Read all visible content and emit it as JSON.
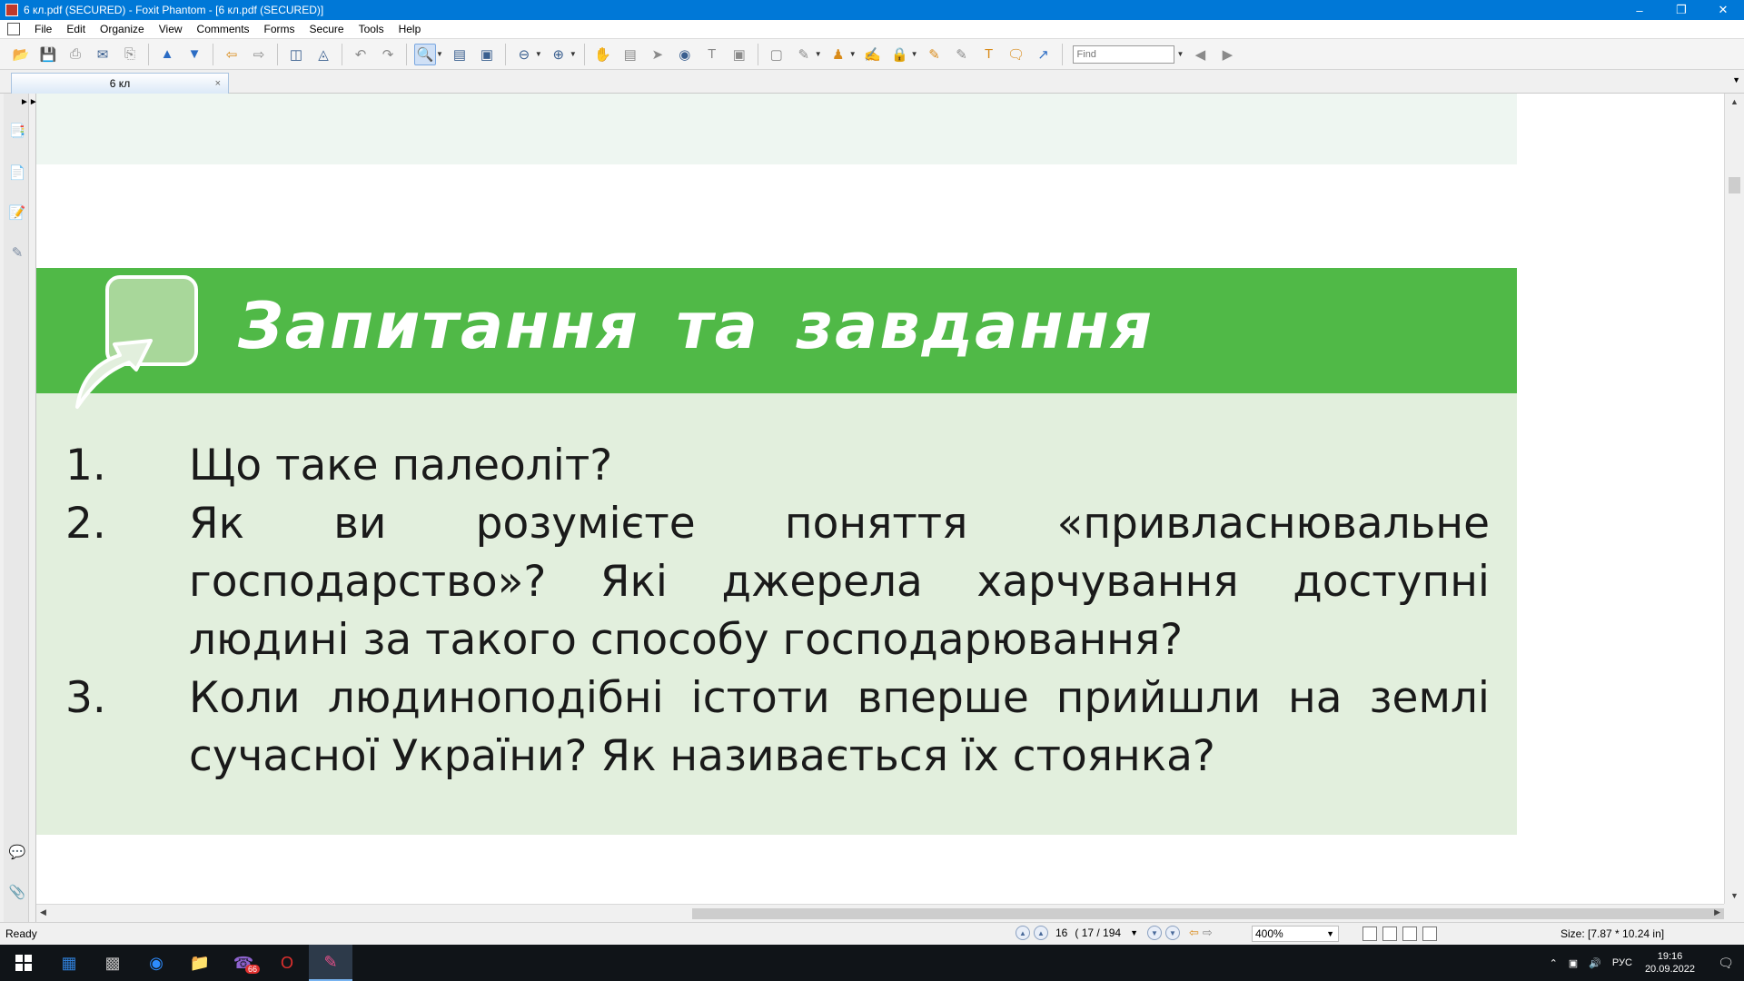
{
  "window": {
    "title": "6 кл.pdf (SECURED) - Foxit Phantom - [6 кл.pdf (SECURED)]",
    "minimize": "–",
    "restore": "❐",
    "close": "✕"
  },
  "menu": [
    "File",
    "Edit",
    "Organize",
    "View",
    "Comments",
    "Forms",
    "Secure",
    "Tools",
    "Help"
  ],
  "toolbar": {
    "find_placeholder": "Find"
  },
  "tab": {
    "label": "6 кл",
    "close": "×"
  },
  "document": {
    "heading": "Запитання та завдання",
    "questions": [
      {
        "num": "1.",
        "text": "Що таке палеоліт?"
      },
      {
        "num": "2.",
        "text": "Як ви розумієте поняття «привласнювальне господарство»? Які джерела харчування доступні людині за такого способу господарювання?"
      },
      {
        "num": "3.",
        "text": "Коли людиноподібні істоти вперше прийшли на землі сучасної України? Як називається їх стоянка?"
      }
    ],
    "colors": {
      "header_green": "#50b947",
      "content_green": "#e2efdd",
      "top_band": "#eef6f1"
    }
  },
  "status": {
    "ready": "Ready",
    "page_current": "16",
    "page_info": "( 17 / 194",
    "zoom": "400%",
    "size": "Size: [7.87 * 10.24 in]"
  },
  "taskbar": {
    "badge": "66",
    "lang": "РУС",
    "time": "19:16",
    "date": "20.09.2022"
  }
}
